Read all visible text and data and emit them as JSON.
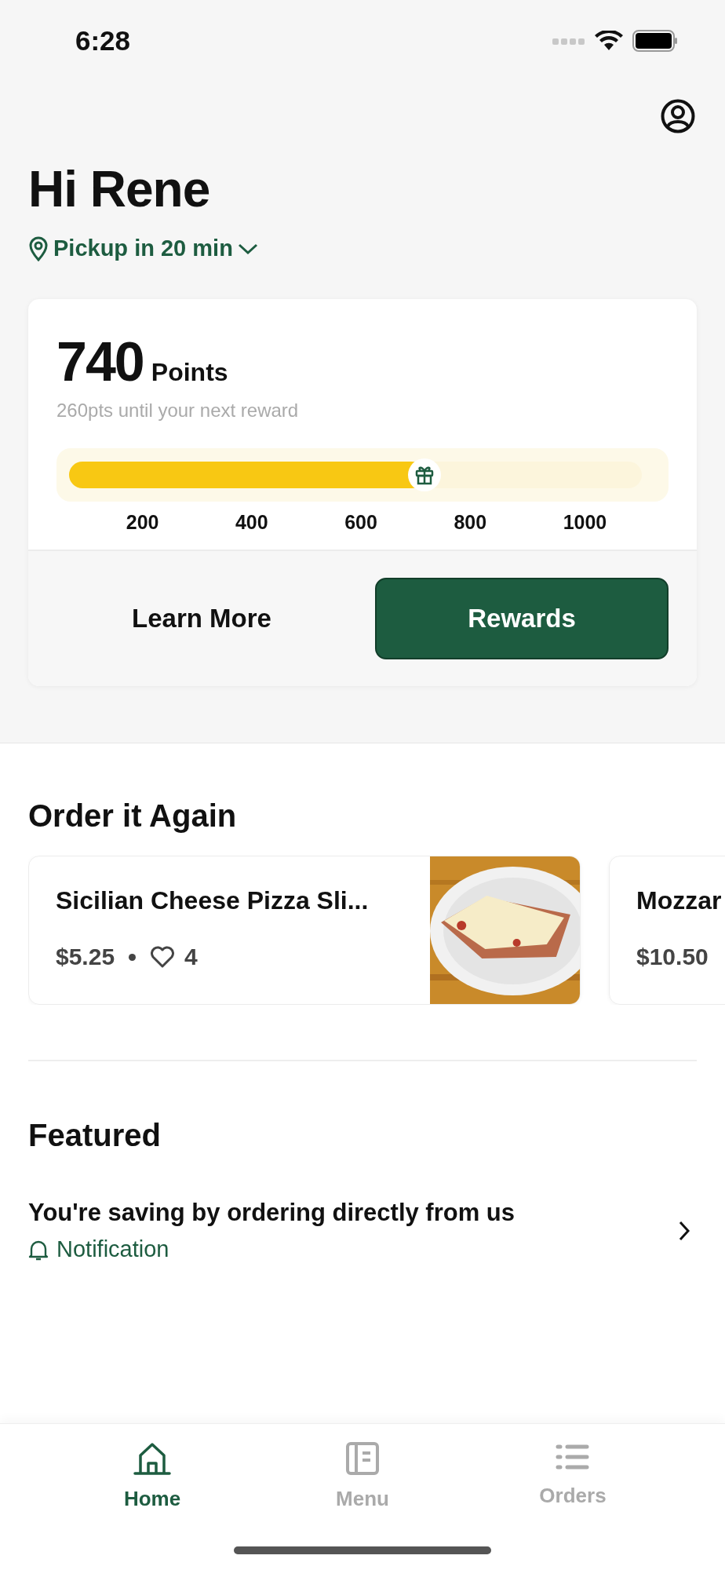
{
  "status_bar": {
    "time": "6:28"
  },
  "greeting": "Hi Rene",
  "pickup": {
    "label": "Pickup in 20 min"
  },
  "rewards": {
    "points": "740",
    "points_label": "Points",
    "subtitle": "260pts until your next reward",
    "level": 0.62,
    "ticks": [
      "200",
      "400",
      "600",
      "800",
      "1000"
    ],
    "buttons": [
      {
        "label": "Learn More",
        "kind": "plain"
      },
      {
        "label": "Rewards",
        "kind": "primary"
      }
    ]
  },
  "order_again": {
    "title": "Order it Again",
    "items": [
      {
        "name": "Sicilian Cheese Pizza Sli...",
        "price": "$5.25",
        "likes": "4",
        "kind": "picture"
      },
      {
        "name": "Mozzar",
        "price": "$10.50"
      }
    ]
  },
  "featured": {
    "title": "Featured",
    "items": [
      {
        "title": "You're saving by ordering directly from us",
        "tag": "Notification"
      }
    ]
  },
  "tab_bar": [
    {
      "label": "Home",
      "kind": "home",
      "selected": true
    },
    {
      "label": "Menu",
      "kind": "menu",
      "selected": false
    },
    {
      "label": "Orders",
      "kind": "orders",
      "selected": false
    }
  ]
}
